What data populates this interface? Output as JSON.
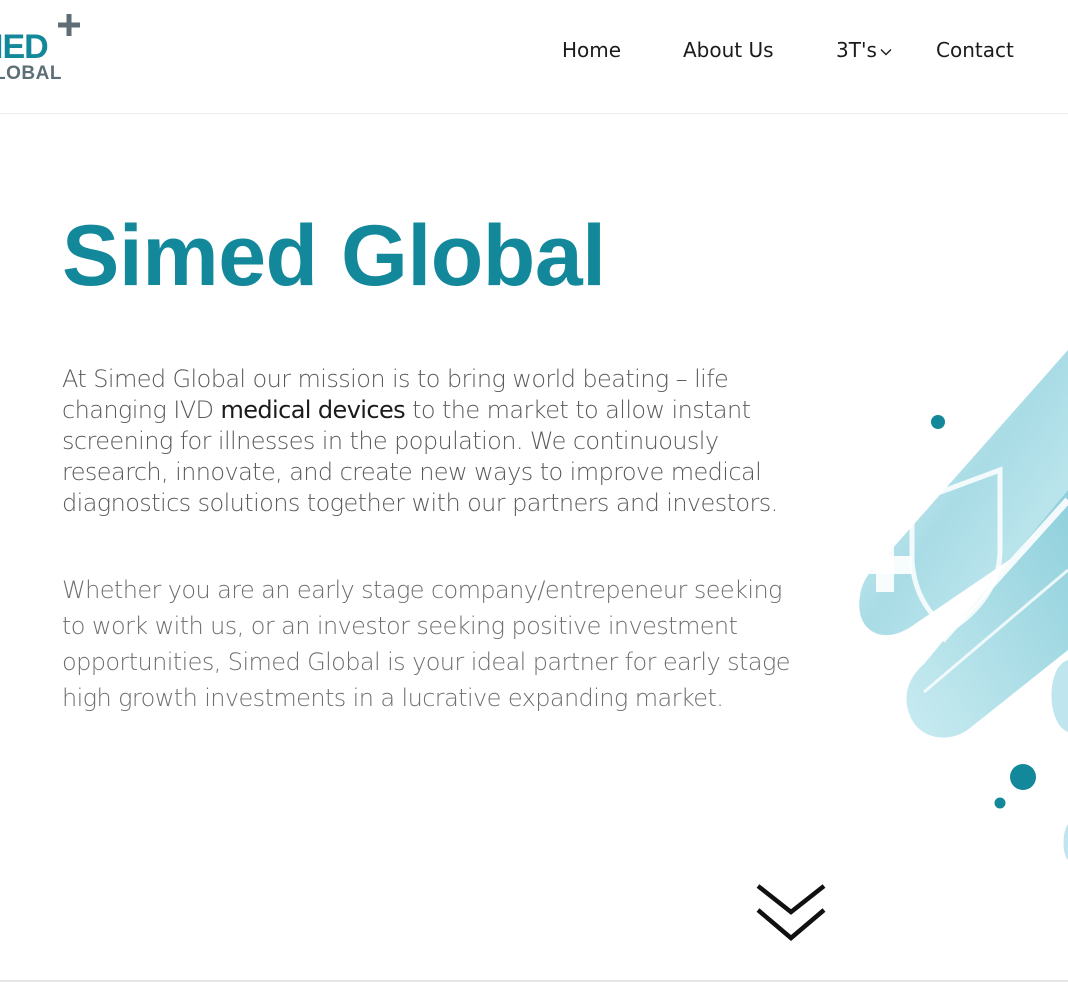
{
  "brand": {
    "logo_top": "IED",
    "logo_bottom": "LOBAL",
    "accent_color": "#12889a",
    "secondary_color": "#5e6e76"
  },
  "nav": {
    "items": [
      {
        "label": "Home"
      },
      {
        "label": "About Us"
      },
      {
        "label": "3T's",
        "has_dropdown": true
      },
      {
        "label": "Contact"
      }
    ]
  },
  "hero": {
    "title": "Simed Global",
    "para1_before": "At Simed Global our mission is to bring world beating – life changing IVD ",
    "para1_link": "medical devices",
    "para1_after": " to the market to allow instant screening for illnesses in the population. We continuously research, innovate, and create new ways to improve medical diagnostics solutions together with our partners and investors.",
    "para2": "Whether you are an early stage company/entrepeneur seeking to work with us, or an investor seeking positive investment opportunities, Simed Global is your ideal partner for early stage high growth investments in a lucrative expanding market.",
    "scroll_icon": "double-chevron-down-icon",
    "art_icon": "medical-shield-illustration"
  }
}
